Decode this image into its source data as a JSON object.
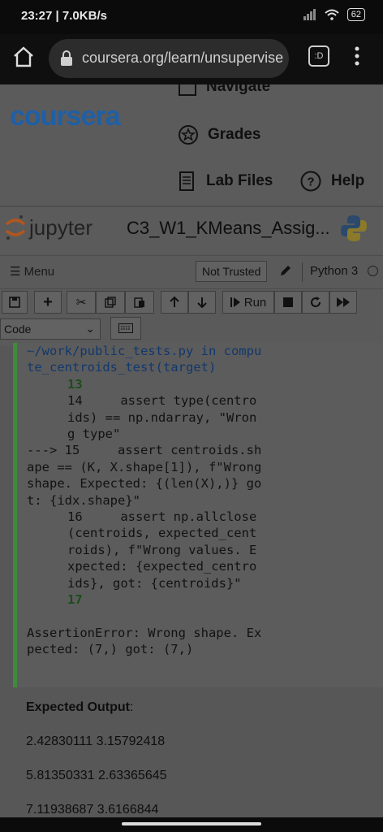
{
  "status_bar": {
    "time": "23:27",
    "speed": "7.0KB/s",
    "battery": "62"
  },
  "browser": {
    "url": "coursera.org/learn/unsupervise",
    "tab_icon_text": ":D"
  },
  "course_header": {
    "logo": "coursera",
    "nav": {
      "navigate": "Navigate",
      "grades": "Grades",
      "lab_files": "Lab Files",
      "help": "Help"
    }
  },
  "jupyter": {
    "logo_text": "jupyter",
    "notebook_title": "C3_W1_KMeans_Assig...",
    "menu_label": "Menu",
    "trust_status": "Not Trusted",
    "kernel": "Python 3",
    "toolbar": {
      "run_label": "Run",
      "cell_type": "Code"
    }
  },
  "cell_output": {
    "lines": [
      "~/work/public_tests.py in compute_centroids_test(target)",
      "13",
      "14     assert type(centroids) == np.ndarray, \"Wrong type\"",
      "---> 15     assert centroids.shape == (K, X.shape[1]), f\"Wrong shape. Expected: {(len(X),)} got: {idx.shape}\"",
      "16     assert np.allclose(centroids, expected_centroids), f\"Wrong values. Expected: {expected_centroids}, got: {centroids}\"",
      "17",
      "AssertionError: Wrong shape. Expected: (7,) got: (7,)"
    ]
  },
  "expected_output": {
    "label": "Expected Output",
    "rows": [
      "2.42830111 3.15792418",
      "5.81350331 2.63365645",
      "7.11938687 3.6166844"
    ]
  },
  "colors": {
    "coursera_blue": "#1f5fa6",
    "cell_border_green": "#3f8a3f"
  }
}
